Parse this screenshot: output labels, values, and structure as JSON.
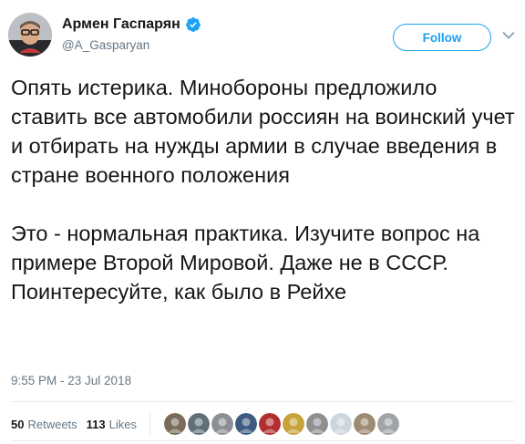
{
  "author": {
    "display_name": "Армен Гаспарян",
    "handle": "@A_Gasparyan",
    "verified": true,
    "avatar_icon": "avatar-photo"
  },
  "follow_button": {
    "label": "Follow"
  },
  "menu_icon": "chevron-down-icon",
  "tweet": {
    "paragraphs": [
      "Опять истерика. Минобороны предложило ставить все автомобили россиян на воинский учет и отбирать на нужды армии в случае введения в стране военного положения",
      "Это - нормальная практика. Изучите вопрос на примере Второй Мировой. Даже не в СССР. Поинтересуйте, как было в Рейхе"
    ],
    "timestamp": "9:55 PM - 23 Jul 2018"
  },
  "stats": {
    "retweets_count": "50",
    "retweets_label": "Retweets",
    "likes_count": "113",
    "likes_label": "Likes"
  },
  "likers": [
    {
      "icon": "user-avatar-1",
      "color": "#7a6b5a"
    },
    {
      "icon": "user-avatar-2",
      "color": "#5f6f7a"
    },
    {
      "icon": "user-avatar-3",
      "color": "#8a8f96"
    },
    {
      "icon": "user-avatar-4",
      "color": "#3d5a80"
    },
    {
      "icon": "user-avatar-5",
      "color": "#b22d2d"
    },
    {
      "icon": "user-avatar-6",
      "color": "#c7a23a"
    },
    {
      "icon": "user-avatar-7",
      "color": "#8f8f8f"
    },
    {
      "icon": "user-avatar-8",
      "color": "#ccd6dd"
    },
    {
      "icon": "user-avatar-9",
      "color": "#9c8a72"
    },
    {
      "icon": "user-avatar-10",
      "color": "#a0a4a8"
    }
  ],
  "colors": {
    "accent": "#1da1f2",
    "text": "#14171a",
    "muted": "#657786",
    "divider": "#e6ecf0"
  }
}
